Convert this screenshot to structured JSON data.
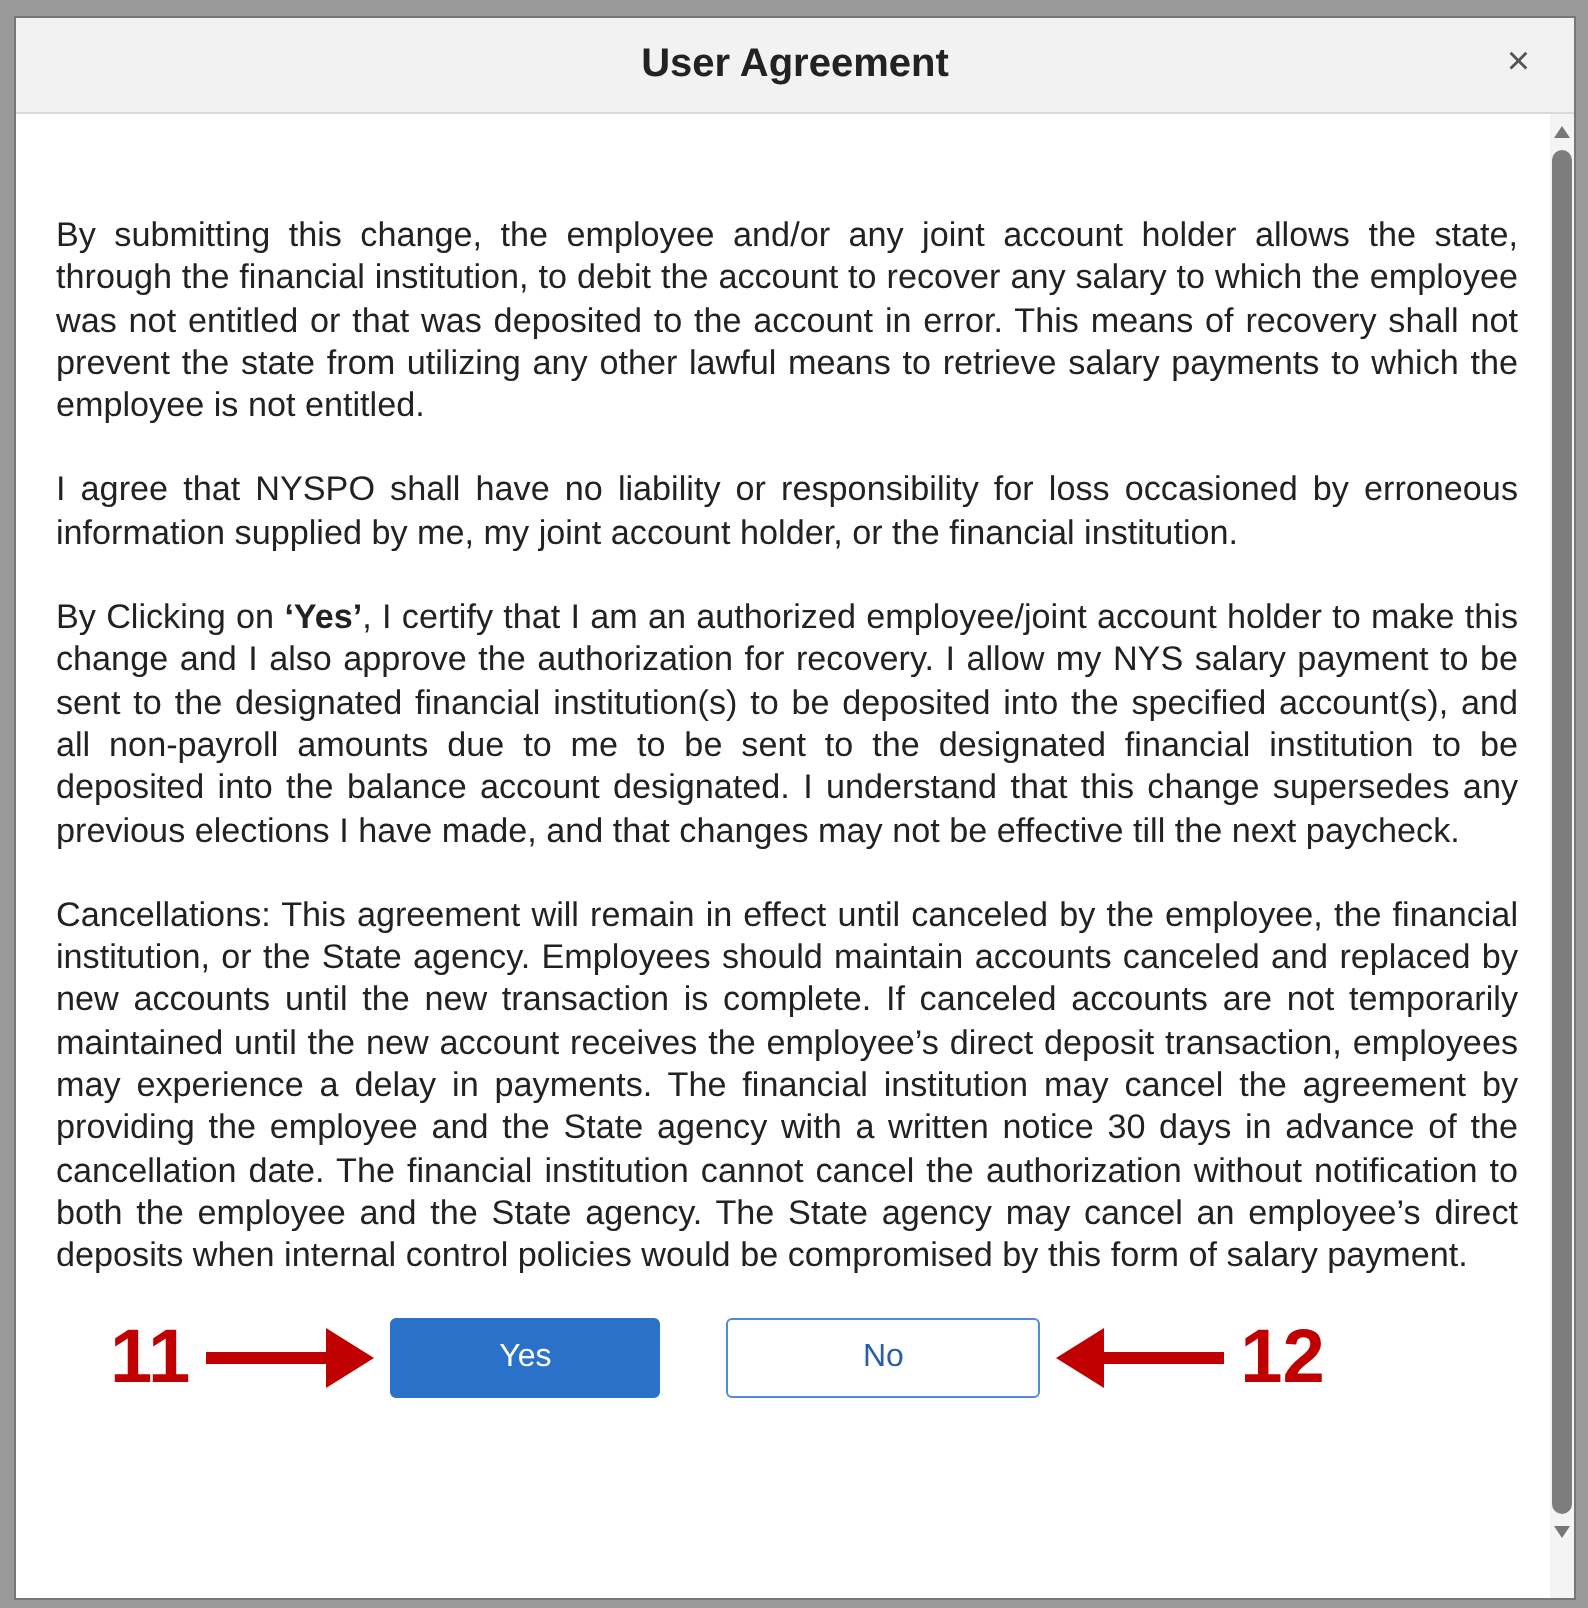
{
  "dialog": {
    "title": "User Agreement",
    "close": "×"
  },
  "paragraphs": [
    "By submitting this change, the employee and/or any joint account holder allows the state, through the financial institution, to debit the account to recover any salary to which the employee was not entitled or that was deposited to the account in error. This means of recovery shall not prevent the state from utilizing any other lawful means to retrieve salary payments to which the employee is not entitled.",
    "I agree that NYSPO shall have no liability or responsibility for loss occasioned by erroneous information supplied by me, my joint account holder, or the financial institution.",
    "By Clicking on **‘Yes’**, I certify that I am an authorized employee/joint account holder to make this change and I also approve the authorization for recovery. I allow my NYS salary payment to be sent to the designated financial institution(s) to be deposited into the specified account(s), and all non-payroll amounts due to me to be sent to the designated financial institution to be deposited into the balance account designated. I understand that this change supersedes any previous elections I have made, and that changes may not be effective till the next paycheck.",
    "Cancellations: This agreement will remain in effect until canceled by the employee, the financial institution, or the State agency. Employees should maintain accounts canceled and replaced by new accounts until the new transaction is complete. If canceled accounts are not temporarily maintained until the new account receives the employee’s direct deposit transaction, employees may experience a delay in payments. The financial institution may cancel the agreement by providing the employee and the State agency with a written notice 30 days in advance of the cancellation date. The financial institution cannot cancel the authorization without notification to both the employee and the State agency. The State agency may cancel an employee’s direct deposits when internal control policies would be compromised by this form of salary payment."
  ],
  "buttons": [
    {
      "label": "Yes",
      "kind": "primary"
    },
    {
      "label": "No",
      "kind": "secondary"
    }
  ],
  "annotations": [
    {
      "label": "11",
      "kind": "before"
    },
    {
      "label": "12",
      "kind": "after"
    }
  ]
}
